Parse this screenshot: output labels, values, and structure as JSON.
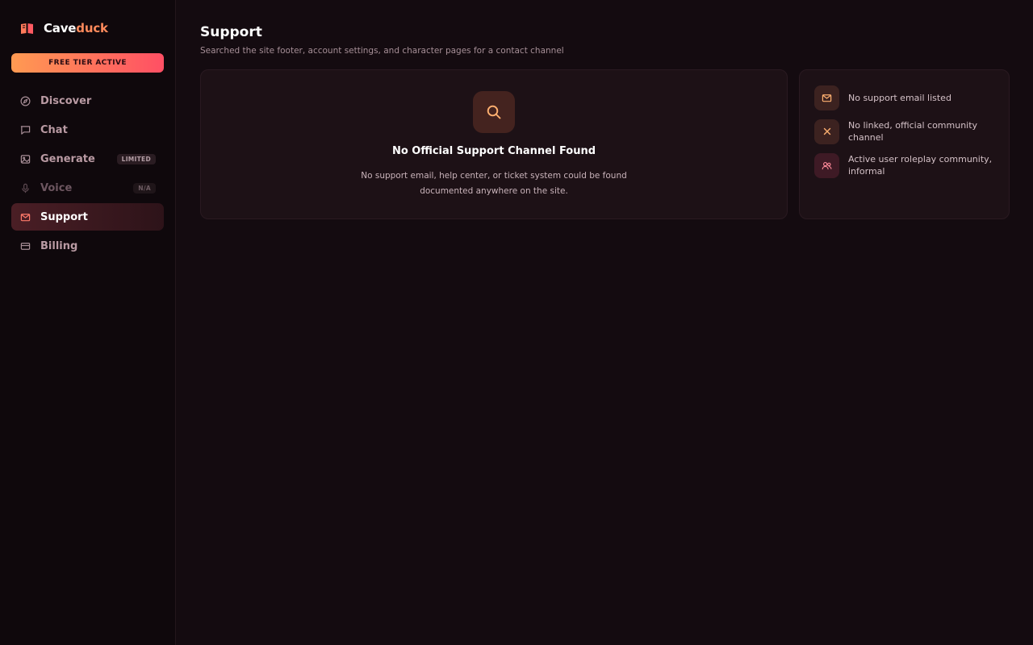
{
  "app": {
    "name_part1": "Cave",
    "name_part2": "duck",
    "tier_badge": "FREE TIER ACTIVE"
  },
  "sidebar": {
    "items": [
      {
        "label": "Discover",
        "icon": "compass-icon"
      },
      {
        "label": "Chat",
        "icon": "chat-bubble-icon"
      },
      {
        "label": "Generate",
        "icon": "image-icon",
        "tag": "LIMITED"
      },
      {
        "label": "Voice",
        "icon": "microphone-icon",
        "tag": "N/A"
      },
      {
        "label": "Support",
        "icon": "mail-icon",
        "active": true
      },
      {
        "label": "Billing",
        "icon": "credit-card-icon"
      }
    ]
  },
  "page": {
    "title": "Support",
    "subtitle": "Searched the site footer, account settings, and character pages for a contact channel"
  },
  "main_card": {
    "icon": "search-icon",
    "title": "No Official Support Channel Found",
    "description": "No support email, help center, or ticket system could be found documented anywhere on the site."
  },
  "side_card": {
    "items": [
      {
        "icon": "mail-icon",
        "text": "No support email listed"
      },
      {
        "icon": "x-icon",
        "text": "No linked, official community channel"
      },
      {
        "icon": "users-icon",
        "text": "Active user roleplay community, informal"
      }
    ]
  },
  "colors": {
    "accent": "#ff8a5c",
    "accent_gradient_start": "#ff9a52",
    "accent_gradient_end": "#ff4f64",
    "background": "#140b10",
    "card": "#1d1116"
  }
}
